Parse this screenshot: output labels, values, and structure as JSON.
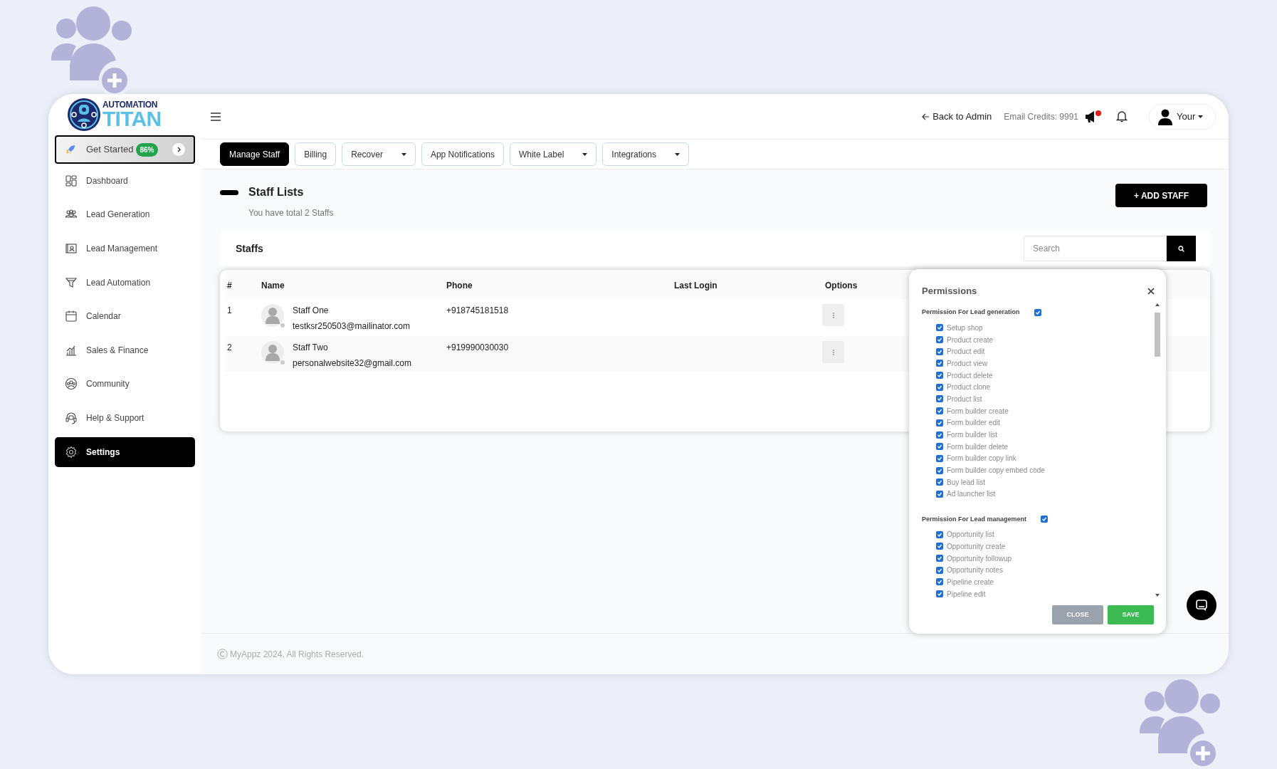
{
  "logo": {
    "line_1": "AUTOMATION",
    "line_2": "TITAN"
  },
  "sidebar": {
    "get_started": {
      "label": "Get Started",
      "badge": "86%"
    },
    "items": [
      {
        "label": "Dashboard",
        "selected": false
      },
      {
        "label": "Lead Generation",
        "selected": false
      },
      {
        "label": "Lead Management",
        "selected": false
      },
      {
        "label": "Lead Automation",
        "selected": false
      },
      {
        "label": "Calendar",
        "selected": false
      },
      {
        "label": "Sales & Finance",
        "selected": false
      },
      {
        "label": "Community",
        "selected": false
      },
      {
        "label": "Help & Support",
        "selected": false
      },
      {
        "label": "Settings",
        "selected": true
      }
    ]
  },
  "header": {
    "back_link": "Back to Admin",
    "email_credits": "Email Credits: 9991",
    "announcements_unread": true,
    "user_menu": "Your"
  },
  "tabs": [
    {
      "label": "Manage Staff",
      "selected": true,
      "dropdown": false
    },
    {
      "label": "Billing",
      "selected": false,
      "dropdown": false
    },
    {
      "label": "Recover",
      "selected": false,
      "dropdown": true
    },
    {
      "label": "App Notifications",
      "selected": false,
      "dropdown": false
    },
    {
      "label": "White Label",
      "selected": false,
      "dropdown": true
    },
    {
      "label": "Integrations",
      "selected": false,
      "dropdown": true
    }
  ],
  "page": {
    "title": "Staff Lists",
    "subtitle": "You have total 2 Staffs",
    "add_button": "+ ADD STAFF"
  },
  "staffs_panel": {
    "title": "Staffs",
    "search": {
      "placeholder": "Search"
    }
  },
  "table": {
    "columns": [
      "#",
      "Name",
      "Phone",
      "Last Login",
      "Options"
    ],
    "rows": [
      {
        "index": "1",
        "name": "Staff One",
        "email": "testksr250503@mailinator.com",
        "phone": "+918745181518"
      },
      {
        "index": "2",
        "name": "Staff Two",
        "email": "personalwebsite32@gmail.com",
        "phone": "+919990030030"
      }
    ]
  },
  "permissions": {
    "title": "Permissions",
    "groups": [
      {
        "title": "Permission For Lead generation",
        "checked": true,
        "items": [
          {
            "label": "Setup shop",
            "checked": true
          },
          {
            "label": "Product create",
            "checked": true
          },
          {
            "label": "Product edit",
            "checked": true
          },
          {
            "label": "Product view",
            "checked": true
          },
          {
            "label": "Product delete",
            "checked": true
          },
          {
            "label": "Product clone",
            "checked": true
          },
          {
            "label": "Product list",
            "checked": true
          },
          {
            "label": "Form builder create",
            "checked": true
          },
          {
            "label": "Form builder edit",
            "checked": true
          },
          {
            "label": "Form builder list",
            "checked": true
          },
          {
            "label": "Form builder delete",
            "checked": true
          },
          {
            "label": "Form builder copy link",
            "checked": true
          },
          {
            "label": "Form builder copy embed code",
            "checked": true
          },
          {
            "label": "Buy lead list",
            "checked": true
          },
          {
            "label": "Ad launcher list",
            "checked": true
          }
        ]
      },
      {
        "title": "Permission For Lead management",
        "checked": true,
        "items": [
          {
            "label": "Opportunity list",
            "checked": true
          },
          {
            "label": "Opportunity create",
            "checked": true
          },
          {
            "label": "Opportunity followup",
            "checked": true
          },
          {
            "label": "Opportunity notes",
            "checked": true
          },
          {
            "label": "Pipeline create",
            "checked": true
          },
          {
            "label": "Pipeline edit",
            "checked": true
          }
        ]
      }
    ],
    "close_button": "CLOSE",
    "save_button": "SAVE"
  },
  "footer": {
    "text": "MyAppz 2024, All Rights Reserved."
  }
}
